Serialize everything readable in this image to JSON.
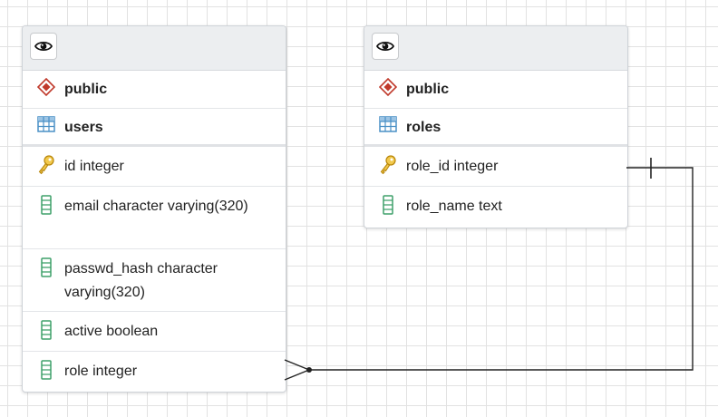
{
  "entities": [
    {
      "id": "users",
      "schema": "public",
      "table": "users",
      "columns": [
        {
          "label": "id integer",
          "icon": "key-icon"
        },
        {
          "label": "email character varying(320)",
          "icon": "column-icon"
        },
        {
          "label": "passwd_hash character varying(320)",
          "icon": "column-icon"
        },
        {
          "label": "active boolean",
          "icon": "column-icon"
        },
        {
          "label": "role integer",
          "icon": "column-icon"
        }
      ]
    },
    {
      "id": "roles",
      "schema": "public",
      "table": "roles",
      "columns": [
        {
          "label": "role_id integer",
          "icon": "key-icon"
        },
        {
          "label": "role_name text",
          "icon": "column-icon"
        }
      ]
    }
  ],
  "relationship": {
    "from": "users.role",
    "to": "roles.role_id",
    "from_end": "many",
    "to_end": "one"
  },
  "colors": {
    "schema": "#c0392b",
    "table": "#4a90c6",
    "key": "#e3b21c",
    "column": "#3fa06a",
    "line": "#222222"
  }
}
